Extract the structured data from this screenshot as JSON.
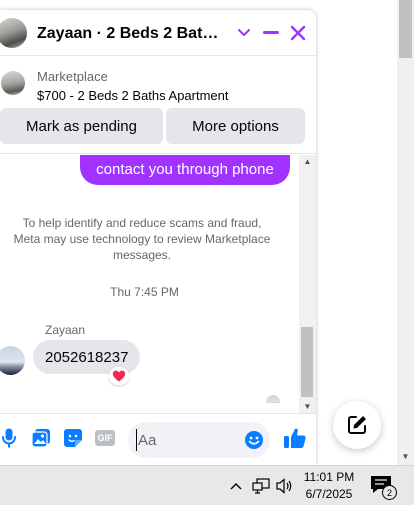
{
  "chat": {
    "title": "Zayaan · 2 Beds 2 Baths Apartment",
    "listing": {
      "source": "Marketplace",
      "title": "$700 - 2 Beds 2 Baths Apartment"
    },
    "actions": {
      "pending": "Mark as pending",
      "more": "More options"
    },
    "messages": {
      "outgoing_text": "contact you through phone",
      "notice": "To help identify and reduce scams and fraud, Meta may use technology to review Marketplace messages.",
      "timestamp": "Thu 7:45 PM",
      "sender": "Zayaan",
      "incoming_text": "2052618237",
      "reaction_icon": "heart-icon"
    },
    "composer": {
      "placeholder": "Aa",
      "value": "",
      "gif_label": "GIF"
    },
    "colors": {
      "accent": "#a033ff",
      "icon_blue": "#0a7cff",
      "reaction": "#f02849"
    }
  },
  "taskbar": {
    "time": "11:01 PM",
    "date": "6/7/2025",
    "notifications": "2"
  }
}
